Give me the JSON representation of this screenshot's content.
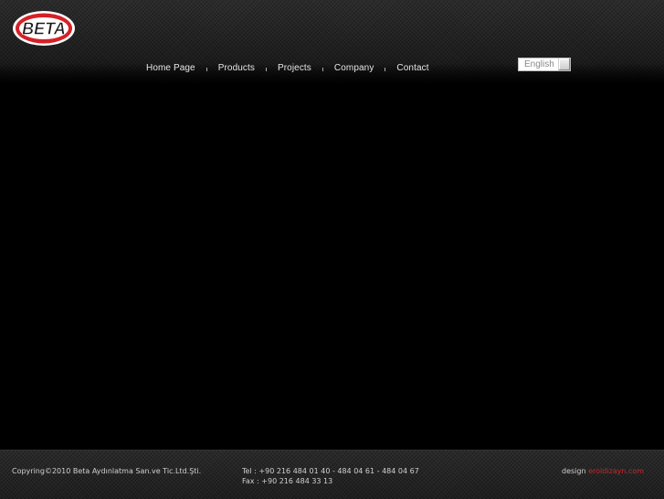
{
  "brand": {
    "logo_text": "BETA",
    "logo_red": "#d42127"
  },
  "nav": {
    "items": [
      {
        "label": "Home Page"
      },
      {
        "label": "Products"
      },
      {
        "label": "Projects"
      },
      {
        "label": "Company"
      },
      {
        "label": "Contact"
      }
    ]
  },
  "language": {
    "selected": "English"
  },
  "footer": {
    "copyright": "Copyring©2010 Beta Aydınlatma San.ve Tic.Ltd.Şti.",
    "tel": "Tel  :    +90 216 484 01 40 -  484 04 61 - 484 04 67",
    "fax": "Fax : +90 216 484 33 13",
    "design_label": "design",
    "design_link": "eroldizayn.com",
    "link_color": "#c8272b"
  }
}
